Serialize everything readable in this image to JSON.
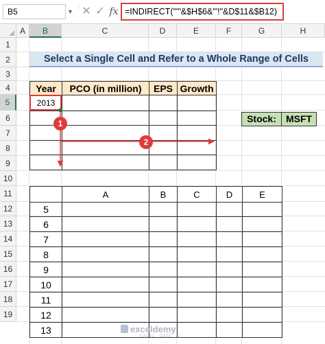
{
  "formula_bar": {
    "name_box": "B5",
    "formula": "=INDIRECT(\"'\"&$H$6&\"'!\"&D$11&$B12)"
  },
  "columns": [
    "A",
    "B",
    "C",
    "D",
    "E",
    "F",
    "G",
    "H"
  ],
  "rows": [
    "1",
    "2",
    "3",
    "4",
    "5",
    "6",
    "7",
    "8",
    "9",
    "10",
    "11",
    "12",
    "13",
    "14",
    "15",
    "16",
    "17",
    "18",
    "19"
  ],
  "selected": {
    "column": "B",
    "row": "5"
  },
  "title": "Select a Single Cell and Refer to a Whole Range of Cells",
  "table1": {
    "headers": [
      "Year",
      "PCO (in million)",
      "EPS",
      "Growth"
    ],
    "first_value": "2013"
  },
  "stock": {
    "label": "Stock:",
    "value": "MSFT"
  },
  "table2": {
    "headers": [
      "A",
      "B",
      "C",
      "D",
      "E"
    ],
    "row_values": [
      "5",
      "6",
      "7",
      "8",
      "9",
      "10",
      "11",
      "12",
      "13"
    ]
  },
  "badges": [
    "1",
    "2"
  ],
  "watermark": {
    "name": "exceldemy",
    "tagline": "EXCEL · DATA · BI"
  },
  "colors": {
    "accent_red": "#e03a3a",
    "excel_green": "#217346",
    "title_fill": "#dbe6f3",
    "header_fill": "#fde9c8",
    "stock_fill": "#c6e0b4"
  }
}
